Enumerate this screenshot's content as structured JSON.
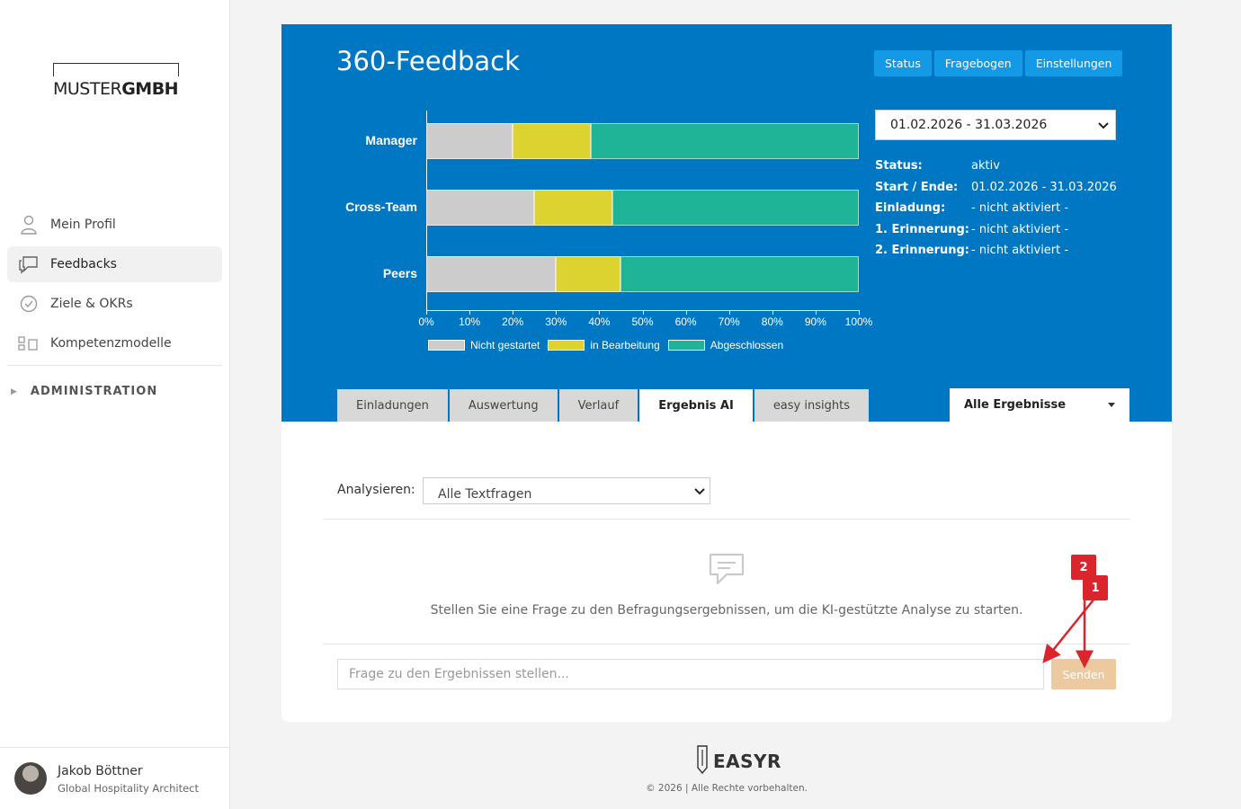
{
  "sidebar": {
    "logo_thin": "MUSTER",
    "logo_bold": "GMBH",
    "items": [
      {
        "label": "Mein Profil",
        "icon": "user-icon"
      },
      {
        "label": "Feedbacks",
        "icon": "chat-bubbles-icon",
        "active": true
      },
      {
        "label": "Ziele & OKRs",
        "icon": "check-circle-icon"
      },
      {
        "label": "Kompetenzmodelle",
        "icon": "competency-icon"
      }
    ],
    "admin_label": "ADMINISTRATION",
    "user": {
      "name": "Jakob Böttner",
      "role": "Global Hospitality Architect"
    }
  },
  "header": {
    "title": "360-Feedback",
    "buttons": [
      "Status",
      "Fragebogen",
      "Einstellungen"
    ]
  },
  "chart_data": {
    "type": "bar",
    "orientation": "horizontal",
    "stacked": true,
    "categories": [
      "Manager",
      "Cross-Team",
      "Peers"
    ],
    "series": [
      {
        "name": "Nicht gestartet",
        "values": [
          20,
          25,
          30
        ],
        "color": "#cccccc"
      },
      {
        "name": "in Bearbeitung",
        "values": [
          18,
          18,
          15
        ],
        "color": "#dcd331"
      },
      {
        "name": "Abgeschlossen",
        "values": [
          62,
          57,
          55
        ],
        "color": "#1fb497"
      }
    ],
    "xticks": [
      "0%",
      "10%",
      "20%",
      "30%",
      "40%",
      "50%",
      "60%",
      "70%",
      "80%",
      "90%",
      "100%"
    ],
    "xlim": [
      0,
      100
    ],
    "legend": "bottom"
  },
  "period": {
    "selected": "01.02.2026 - 31.03.2026"
  },
  "info": [
    {
      "key": "Status:",
      "value": "aktiv"
    },
    {
      "key": "Start / Ende:",
      "value": "01.02.2026 - 31.03.2026"
    },
    {
      "key": "Einladung:",
      "value": "- nicht aktiviert -"
    },
    {
      "key": "1. Erinnerung:",
      "value": "- nicht aktiviert -"
    },
    {
      "key": "2. Erinnerung:",
      "value": "- nicht aktiviert -"
    }
  ],
  "tabs": [
    {
      "label": "Einladungen"
    },
    {
      "label": "Auswertung"
    },
    {
      "label": "Verlauf"
    },
    {
      "label": "Ergebnis AI",
      "active": true
    },
    {
      "label": "easy insights"
    }
  ],
  "results_filter": "Alle Ergebnisse",
  "analyze": {
    "label": "Analysieren:",
    "selected": "Alle Textfragen"
  },
  "hint": "Stellen Sie eine Frage zu den Befragungsergebnissen, um die KI-gestützte Analyse zu starten.",
  "question": {
    "placeholder": "Frage zu den Ergebnissen stellen...",
    "send_label": "Senden"
  },
  "annotations": [
    "2",
    "1"
  ],
  "footer": {
    "brand": "EASYR",
    "copyright": "© 2026 | Alle Rechte vorbehalten."
  }
}
